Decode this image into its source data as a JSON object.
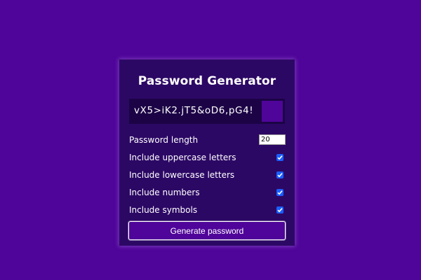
{
  "app": {
    "title": "Password Generator"
  },
  "result": {
    "password": "vX5>iK2.jT5&oD6,pG4!"
  },
  "settings": {
    "length": {
      "label": "Password length",
      "value": "20"
    },
    "uppercase": {
      "label": "Include uppercase letters",
      "checked": true
    },
    "lowercase": {
      "label": "Include lowercase letters",
      "checked": true
    },
    "numbers": {
      "label": "Include numbers",
      "checked": true
    },
    "symbols": {
      "label": "Include symbols",
      "checked": true
    }
  },
  "actions": {
    "generate_label": "Generate password"
  },
  "colors": {
    "background": "#4f0599",
    "card": "#2c0865",
    "result_box": "#1c0346",
    "checkbox": "#1a5fff"
  }
}
